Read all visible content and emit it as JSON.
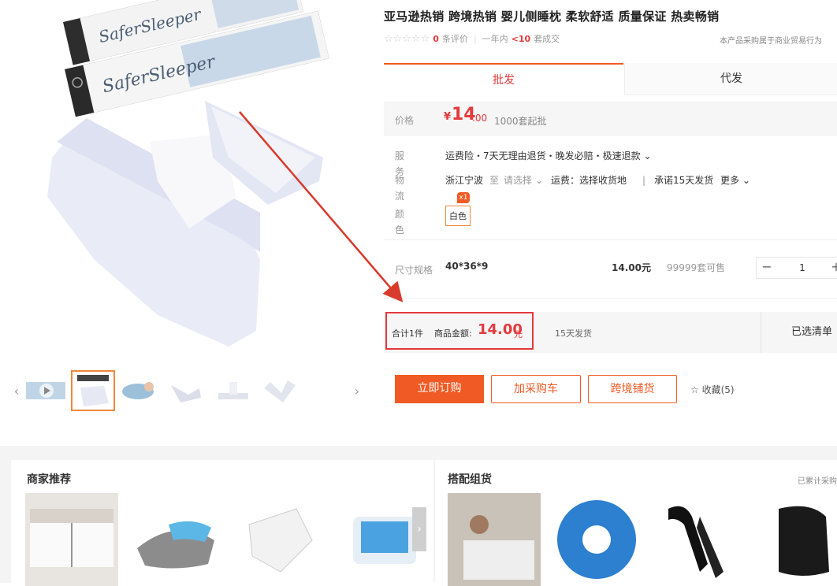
{
  "product": {
    "title": "亚马逊热销 跨境热销 婴儿侧睡枕 柔软舒适 质量保证 热卖畅销",
    "rating_stars": "☆☆☆☆☆",
    "review_count": "0",
    "review_suffix": "条评价",
    "year_label": "一年内",
    "year_value": "<10",
    "year_suffix": "套成交",
    "trade_note": "本产品采购属于商业贸易行为",
    "box_brand": "SaferSleeper"
  },
  "tabs": {
    "wholesale": "批发",
    "dropship": "代发"
  },
  "price": {
    "label": "价格",
    "yen": "¥",
    "integer": "14",
    "decimal": ".00",
    "moq": "1000套起批"
  },
  "service": {
    "label": "服务",
    "value": "运费险・7天无理由退货・晚发必赔・极速退款 ⌄",
    "logistics_label": "物流",
    "origin": "浙江宁波",
    "to": "至",
    "destination": "请选择",
    "dest_chevron": "⌄",
    "freight": "运费：选择收货地",
    "promise": "承诺15天发货",
    "more": "更多 ⌄",
    "color_label": "颜色",
    "color_value": "白色",
    "color_qty_badge": "x1"
  },
  "spec": {
    "label": "尺寸规格",
    "size": "40*36*9",
    "price": "14.00元",
    "stock": "99999套可售",
    "qty": "1",
    "minus": "−",
    "plus": "+"
  },
  "summary": {
    "total_items": "合计1件",
    "amount_label": "商品金额:",
    "amount": "14.00",
    "yuan": "元",
    "delivery": "15天发货",
    "selected_list": "已选清单"
  },
  "actions": {
    "order_now": "立即订购",
    "add_cart": "加采购车",
    "cross_border": "跨境铺货",
    "favorite": "☆ 收藏(5)"
  },
  "gallery": {
    "prev": "‹",
    "next": "›"
  },
  "recommend": {
    "merchant_title": "商家推荐",
    "bundle_title": "搭配组货",
    "accumulated": "已累计采购",
    "next_arrow": "›",
    "badge": "G"
  },
  "colors": {
    "accent": "#f05a24",
    "price_red": "#e4393c",
    "arrow_red": "#d83a2c"
  }
}
